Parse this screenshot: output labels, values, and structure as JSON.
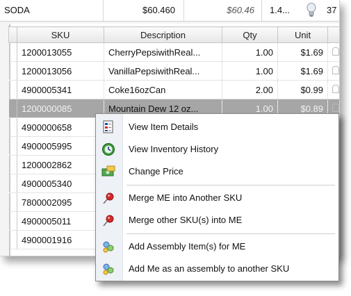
{
  "summary": {
    "name": "SODA",
    "value1": "$60.460",
    "value2": "$60.46",
    "value3": "1.4...",
    "value4": "37"
  },
  "columns": [
    "SKU",
    "Description",
    "Qty",
    "Unit"
  ],
  "rows": [
    {
      "sku": "1200013055",
      "desc": "CherryPepsiwithReal...",
      "qty": "1.00",
      "unit": "$1.69"
    },
    {
      "sku": "1200013056",
      "desc": "VanillaPepsiwithReal...",
      "qty": "1.00",
      "unit": "$1.69"
    },
    {
      "sku": "4900005341",
      "desc": "Coke16ozCan",
      "qty": "2.00",
      "unit": "$0.99"
    },
    {
      "sku": "1200000085",
      "desc": "Mountain Dew 12 oz...",
      "qty": "1.00",
      "unit": "$0.89"
    },
    {
      "sku": "4900000658",
      "desc": "",
      "qty": "",
      "unit": ""
    },
    {
      "sku": "4900005995",
      "desc": "",
      "qty": "",
      "unit": ""
    },
    {
      "sku": "1200002862",
      "desc": "",
      "qty": "",
      "unit": ""
    },
    {
      "sku": "4900005340",
      "desc": "",
      "qty": "",
      "unit": ""
    },
    {
      "sku": "7800002095",
      "desc": "",
      "qty": "",
      "unit": ""
    },
    {
      "sku": "4900005011",
      "desc": "",
      "qty": "",
      "unit": ""
    },
    {
      "sku": "4900001916",
      "desc": "",
      "qty": "",
      "unit": ""
    }
  ],
  "selected_row": 3,
  "context_menu": {
    "items": [
      {
        "label": "View Item Details",
        "icon": "item-details-icon"
      },
      {
        "label": "View Inventory History",
        "icon": "inventory-history-icon"
      },
      {
        "label": "Change Price",
        "icon": "change-price-icon"
      },
      {
        "label": "Merge ME into Another SKU",
        "icon": "pushpin-icon"
      },
      {
        "label": "Merge other SKU(s) into ME",
        "icon": "pushpin-icon"
      },
      {
        "label": "Add Assembly Item(s) for ME",
        "icon": "assembly-icon"
      },
      {
        "label": "Add Me as an assembly to another SKU",
        "icon": "assembly-icon"
      }
    ]
  },
  "colors": {
    "selected_row": "#a6a6a6",
    "menu_gutter": "#eef1f5",
    "pin_red": "#d22a2a"
  }
}
